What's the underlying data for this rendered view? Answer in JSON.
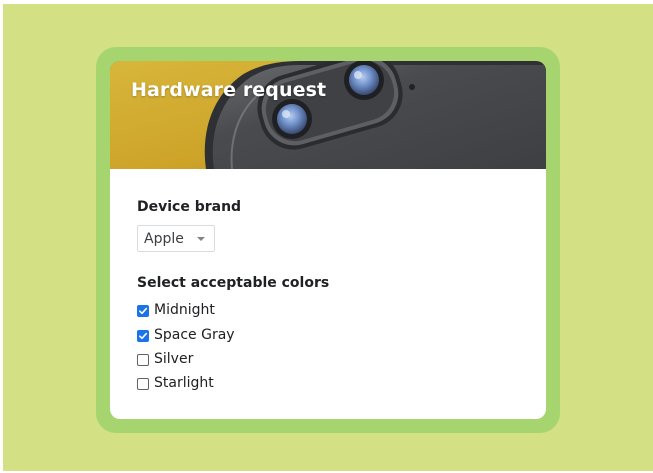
{
  "form": {
    "title": "Hardware request",
    "brand": {
      "label": "Device brand",
      "selected": "Apple"
    },
    "colors": {
      "label": "Select acceptable colors",
      "options": [
        {
          "label": "Midnight",
          "checked": true
        },
        {
          "label": "Space Gray",
          "checked": true
        },
        {
          "label": "Silver",
          "checked": false
        },
        {
          "label": "Starlight",
          "checked": false
        }
      ]
    }
  },
  "theme": {
    "background": "#d3e084",
    "frame": "#a6d46f",
    "accent": "#1a73e8"
  },
  "icons": {
    "dropdown": "chevron-down-icon",
    "check": "checkmark-icon"
  }
}
